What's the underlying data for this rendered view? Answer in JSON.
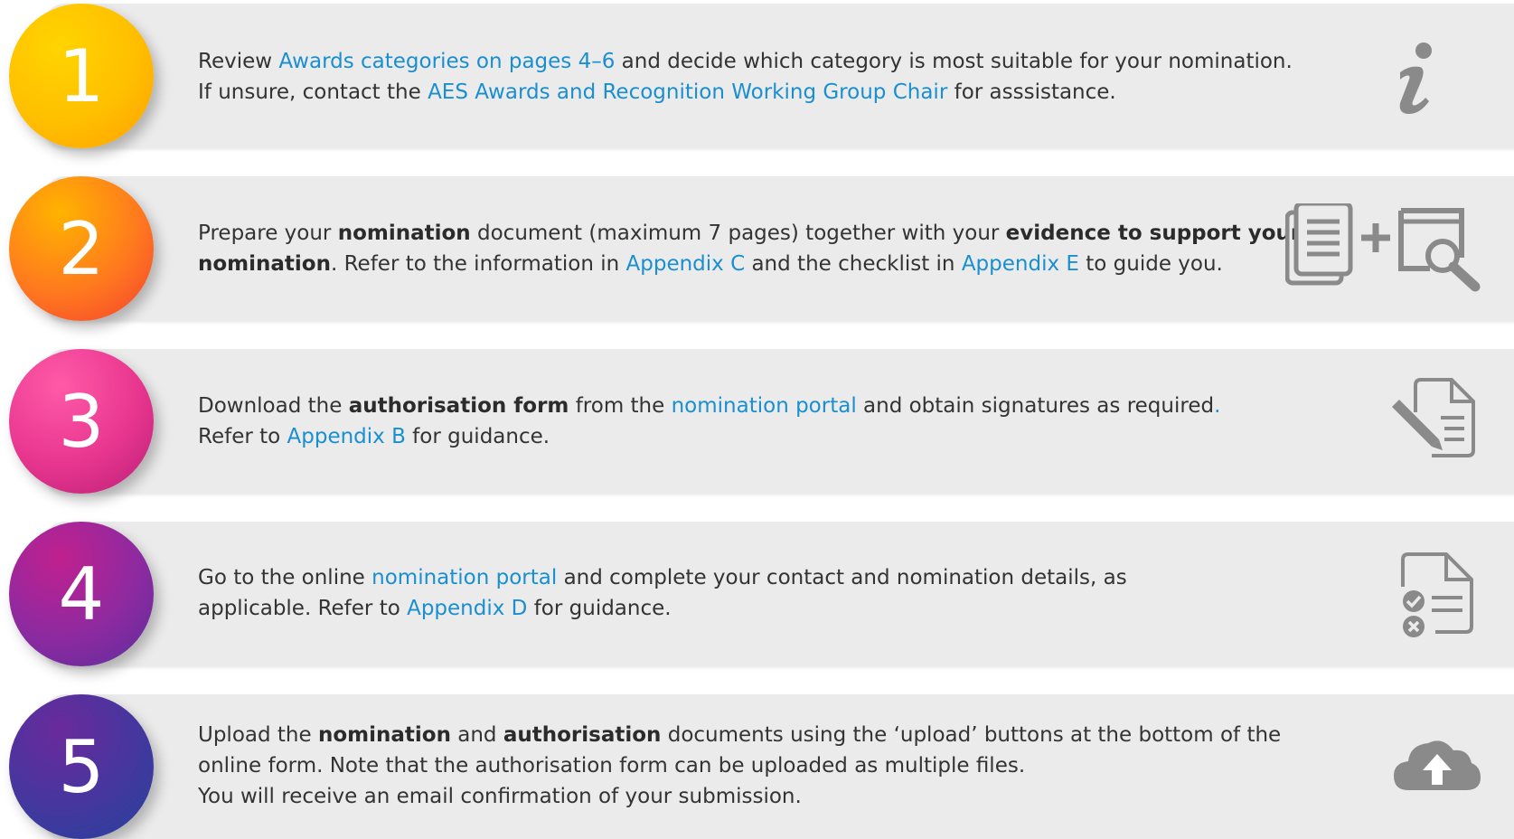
{
  "steps": [
    {
      "number": "1",
      "lines": [
        [
          {
            "t": "Review "
          },
          {
            "t": "Awards categories on pages 4–6",
            "style": "link"
          },
          {
            "t": " and decide which category is most suitable for your nomination."
          }
        ],
        [
          {
            "t": "If unsure, contact the "
          },
          {
            "t": "AES Awards and Recognition Working Group Chair",
            "style": "link"
          },
          {
            "t": " for asssistance."
          }
        ]
      ],
      "icon": "info-icon"
    },
    {
      "number": "2",
      "lines": [
        [
          {
            "t": "Prepare your "
          },
          {
            "t": "nomination",
            "style": "bold"
          },
          {
            "t": " document (maximum 7 pages) together with your "
          },
          {
            "t": "evidence to support your",
            "style": "bold"
          }
        ],
        [
          {
            "t": "nomination",
            "style": "bold"
          },
          {
            "t": ". Refer to the information in "
          },
          {
            "t": "Appendix C",
            "style": "link"
          },
          {
            "t": " and the checklist in "
          },
          {
            "t": "Appendix E",
            "style": "link"
          },
          {
            "t": " to guide you."
          }
        ]
      ],
      "icon": "documents-plus-search-icon"
    },
    {
      "number": "3",
      "lines": [
        [
          {
            "t": "Download the "
          },
          {
            "t": "authorisation form",
            "style": "bold"
          },
          {
            "t": " from the "
          },
          {
            "t": "nomination portal",
            "style": "link"
          },
          {
            "t": " and obtain signatures as required"
          },
          {
            "t": ".",
            "style": "link"
          }
        ],
        [
          {
            "t": "Refer to "
          },
          {
            "t": "Appendix B",
            "style": "link"
          },
          {
            "t": " for guidance."
          }
        ]
      ],
      "icon": "sign-document-icon"
    },
    {
      "number": "4",
      "lines": [
        [
          {
            "t": "Go to the online "
          },
          {
            "t": "nomination portal",
            "style": "link"
          },
          {
            "t": " and complete your contact and nomination details, as"
          }
        ],
        [
          {
            "t": "applicable. Refer to "
          },
          {
            "t": "Appendix D",
            "style": "link"
          },
          {
            "t": " for guidance."
          }
        ]
      ],
      "icon": "checklist-document-icon"
    },
    {
      "number": "5",
      "lines": [
        [
          {
            "t": "Upload the "
          },
          {
            "t": "nomination",
            "style": "bold"
          },
          {
            "t": " and "
          },
          {
            "t": "authorisation",
            "style": "bold"
          },
          {
            "t": " documents using the ‘upload’ buttons at the bottom of the"
          }
        ],
        [
          {
            "t": "online form. Note that the authorisation form can be uploaded as multiple files."
          }
        ],
        [
          {
            "t": "You will receive an email confirmation of your submission."
          }
        ]
      ],
      "icon": "cloud-upload-icon"
    }
  ],
  "colors": {
    "link": "#1a8fd0",
    "text": "#333333",
    "card": "#ebebeb",
    "icon": "#8a8a8a"
  }
}
